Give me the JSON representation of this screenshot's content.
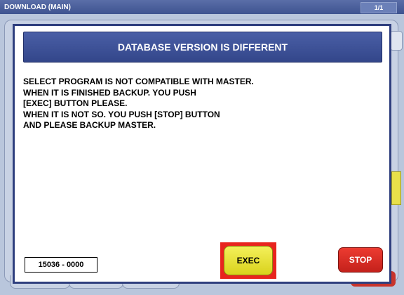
{
  "window": {
    "title": "DOWNLOAD (MAIN)",
    "page_indicator": "1/1"
  },
  "dialog": {
    "title": "DATABASE VERSION IS DIFFERENT",
    "message_lines": [
      "SELECT PROGRAM IS NOT COMPATIBLE WITH MASTER.",
      "WHEN IT IS FINISHED BACKUP. YOU PUSH",
      "[EXEC] BUTTON PLEASE.",
      "WHEN IT IS NOT SO. YOU PUSH [STOP] BUTTON",
      "AND PLEASE BACKUP MASTER."
    ],
    "code": "15036 - 0000",
    "exec_label": "EXEC",
    "stop_label": "STOP"
  },
  "colors": {
    "header_blue": "#3e5390",
    "exec_yellow": "#e8e04a",
    "exec_highlight": "#e8241e",
    "stop_red": "#d42a22"
  }
}
